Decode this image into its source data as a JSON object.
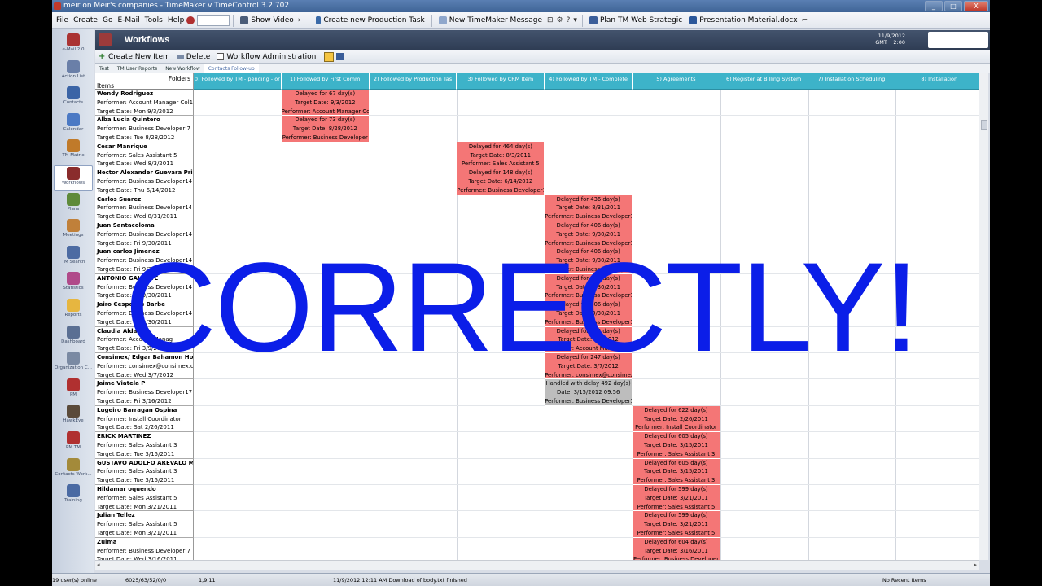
{
  "window": {
    "title": "meir on Meir's companies - TimeMaker v TimeControl 3.2.702",
    "buttons": [
      "_",
      "□",
      "X"
    ]
  },
  "menu": {
    "items": [
      "File",
      "Create",
      "Go",
      "E-Mail",
      "Tools",
      "Help"
    ],
    "toolbar": {
      "show_video": "Show Video",
      "create_task": "Create new Production Task",
      "new_message": "New TimeMaker Message",
      "doc1": "Plan TM Web Strategic",
      "doc2": "Presentation Material.docx"
    }
  },
  "leftnav": {
    "items": [
      "e-Mail 2.0",
      "Action List",
      "Contacts",
      "Calendar",
      "TM Matrix",
      "Workflows",
      "Plans",
      "Meetings",
      "TM Search",
      "Statistics",
      "Reports",
      "Dashboard",
      "Organization C...",
      "PM",
      "HawkEye",
      "PM TM",
      "Contacts Work...",
      "Training"
    ],
    "active_index": 5
  },
  "header": {
    "title": "Workflows",
    "date": "11/9/2012",
    "tz": "GMT +2:00"
  },
  "actions": {
    "create": "Create New Item",
    "delete": "Delete",
    "admin": "Workflow Administration"
  },
  "view_tabs": [
    "Test",
    "TM User Reports",
    "New Workflow",
    "Contacts Follow-up"
  ],
  "grid": {
    "corner_folders": "Folders",
    "corner_items": "Items",
    "columns": [
      "0) Followed by TM - pending - or",
      "1) Followed by First Comm",
      "2) Followed by Production Tas",
      "3) Followed by CRM Item",
      "4) Followed by TM - Complete",
      "5) Agreements",
      "6) Register at Billing System",
      "7) Installation Scheduling",
      "8) Installation"
    ],
    "rows": [
      {
        "name": "Wendy Rodriguez",
        "performer": "Performer: Account Manager Col1",
        "date": "Target Date: Mon 9/3/2012"
      },
      {
        "name": "Alba Lucia Quintero",
        "performer": "Performer: Business Developer 7",
        "date": "Target Date: Tue 8/28/2012"
      },
      {
        "name": "Cesar Manrique",
        "performer": "Performer: Sales Assistant 5",
        "date": "Target Date: Wed 8/3/2011"
      },
      {
        "name": "Hector Alexander Guevara Pri",
        "performer": "Performer: Business Developer14",
        "date": "Target Date: Thu 6/14/2012"
      },
      {
        "name": "Carlos Suarez",
        "performer": "Performer: Business Developer14",
        "date": "Target Date: Wed 8/31/2011"
      },
      {
        "name": "Juan Santacoloma",
        "performer": "Performer: Business Developer14",
        "date": "Target Date: Fri 9/30/2011"
      },
      {
        "name": "Juan carlos Jimenez",
        "performer": "Performer: Business Developer14",
        "date": "Target Date: Fri 9/30/2011"
      },
      {
        "name": "ANTONIO GALANTE",
        "performer": "Performer: Business Developer14",
        "date": "Target Date: Fri 9/30/2011"
      },
      {
        "name": "Jairo Cespedes Barbe",
        "performer": "Performer: Business Developer14",
        "date": "Target Date: Fri 9/30/2011"
      },
      {
        "name": "Claudia Aldana",
        "performer": "Performer: Account Manag",
        "date": "Target Date: Fri 3/9/2012"
      },
      {
        "name": "Consimex/ Edgar Bahamon Ho",
        "performer": "Performer: consimex@consimex.c",
        "date": "Target Date: Wed 3/7/2012"
      },
      {
        "name": "Jaime Viatela P",
        "performer": "Performer: Business Developer17",
        "date": "Target Date: Fri 3/16/2012"
      },
      {
        "name": "Lugeiro Barragan Ospina",
        "performer": "Performer: Install Coordinator",
        "date": "Target Date: Sat 2/26/2011"
      },
      {
        "name": "ERICK MARTINEZ",
        "performer": "Performer: Sales Assistant 3",
        "date": "Target Date: Tue 3/15/2011"
      },
      {
        "name": "GUSTAVO ADOLFO AREVALO MO",
        "performer": "Performer: Sales Assistant 3",
        "date": "Target Date: Tue 3/15/2011"
      },
      {
        "name": "Hildamar oquendo",
        "performer": "Performer: Sales Assistant 5",
        "date": "Target Date: Mon 3/21/2011"
      },
      {
        "name": "Julian Tellez",
        "performer": "Performer: Sales Assistant 5",
        "date": "Target Date: Mon 3/21/2011"
      },
      {
        "name": "Zulma",
        "performer": "Performer: Business Developer 7",
        "date": "Target Date: Wed 3/16/2011"
      }
    ],
    "cells": [
      {
        "row": 0,
        "col": 1,
        "kind": "red",
        "lines": [
          "Delayed for 67 day(s)",
          "Target Date: 9/3/2012",
          "Performer: Account Manager Col"
        ]
      },
      {
        "row": 1,
        "col": 1,
        "kind": "red",
        "lines": [
          "Delayed for 73 day(s)",
          "Target Date: 8/28/2012",
          "Performer: Business Developer"
        ]
      },
      {
        "row": 2,
        "col": 3,
        "kind": "red",
        "lines": [
          "Delayed for 464 day(s)",
          "Target Date: 8/3/2011",
          "Performer: Sales Assistant 5"
        ]
      },
      {
        "row": 3,
        "col": 3,
        "kind": "red",
        "lines": [
          "Delayed for 148 day(s)",
          "Target Date: 6/14/2012",
          "Performer: Business Developer1"
        ]
      },
      {
        "row": 4,
        "col": 4,
        "kind": "red",
        "lines": [
          "Delayed for 436 day(s)",
          "Target Date: 8/31/2011",
          "Performer: Business Developer1"
        ]
      },
      {
        "row": 5,
        "col": 4,
        "kind": "red",
        "lines": [
          "Delayed for 406 day(s)",
          "Target Date: 9/30/2011",
          "Performer: Business Developer1"
        ]
      },
      {
        "row": 6,
        "col": 4,
        "kind": "red",
        "lines": [
          "Delayed for 406 day(s)",
          "Target Date: 9/30/2011",
          "Performer: Business Developer1"
        ]
      },
      {
        "row": 7,
        "col": 4,
        "kind": "red",
        "lines": [
          "Delayed for 406 day(s)",
          "Target Date: 9/30/2011",
          "Performer: Business Developer1"
        ]
      },
      {
        "row": 8,
        "col": 4,
        "kind": "red",
        "lines": [
          "Delayed for 406 day(s)",
          "Target Date: 9/30/2011",
          "Performer: Business Developer1"
        ]
      },
      {
        "row": 9,
        "col": 4,
        "kind": "red",
        "lines": [
          "Delayed for 245 day(s)",
          "Target Date: 3/9/2012",
          "Performer: Account Manager Co"
        ]
      },
      {
        "row": 10,
        "col": 4,
        "kind": "red",
        "lines": [
          "Delayed for 247 day(s)",
          "Target Date: 3/7/2012",
          "Performer: consimex@consimex.co"
        ]
      },
      {
        "row": 11,
        "col": 4,
        "kind": "grey",
        "lines": [
          "Handled with delay 492 day(s)",
          "Date: 3/15/2012 09:56",
          "Performer: Business Developer1"
        ]
      },
      {
        "row": 12,
        "col": 5,
        "kind": "red",
        "lines": [
          "Delayed for 622 day(s)",
          "Target Date: 2/26/2011",
          "Performer: Install Coordinator"
        ]
      },
      {
        "row": 13,
        "col": 5,
        "kind": "red",
        "lines": [
          "Delayed for 605 day(s)",
          "Target Date: 3/15/2011",
          "Performer: Sales Assistant 3"
        ]
      },
      {
        "row": 14,
        "col": 5,
        "kind": "red",
        "lines": [
          "Delayed for 605 day(s)",
          "Target Date: 3/15/2011",
          "Performer: Sales Assistant 3"
        ]
      },
      {
        "row": 15,
        "col": 5,
        "kind": "red",
        "lines": [
          "Delayed for 599 day(s)",
          "Target Date: 3/21/2011",
          "Performer: Sales Assistant 5"
        ]
      },
      {
        "row": 16,
        "col": 5,
        "kind": "red",
        "lines": [
          "Delayed for 599 day(s)",
          "Target Date: 3/21/2011",
          "Performer: Sales Assistant 5"
        ]
      },
      {
        "row": 17,
        "col": 5,
        "kind": "red",
        "lines": [
          "Delayed for 604 day(s)",
          "Target Date: 3/16/2011",
          "Performer: Business Developer"
        ]
      }
    ]
  },
  "status": {
    "users": "19 user(s) online",
    "counts": "6025/63/52/0/0",
    "coords": "1,9,11",
    "message": "11/9/2012 12:11 AM Download of body.txt finished",
    "recent": "No Recent Items"
  },
  "overlay_text": "CORRECTLY!",
  "colors": {
    "accent_header": "#3db3c9",
    "delayed": "#f47676",
    "handled": "#bdbdbd",
    "overlay": "#0b1ee8"
  }
}
